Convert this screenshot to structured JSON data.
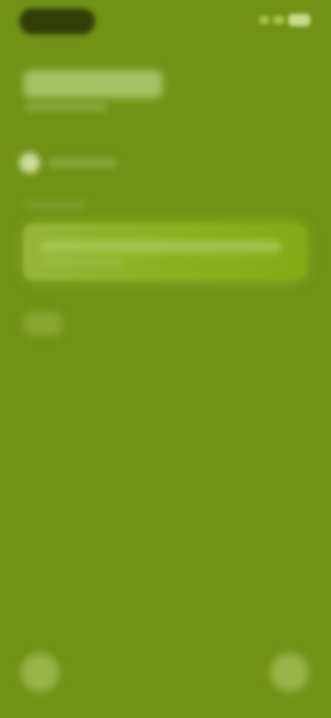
{
  "status_bar": {
    "pill_color": "#2f3a05",
    "icons": [
      "signal-icon",
      "wifi-icon",
      "battery-icon"
    ]
  },
  "header": {
    "title": "",
    "subtitle": ""
  },
  "option": {
    "label": ""
  },
  "section": {
    "label": ""
  },
  "field": {
    "text": "",
    "subtext": ""
  },
  "chip": {
    "label": ""
  },
  "bottom_actions": {
    "left_icon": "circle-button-icon",
    "right_icon": "circle-button-icon"
  },
  "colors": {
    "background": "#729116",
    "accent": "#8cb01f",
    "highlight": "#cfdc9b"
  }
}
